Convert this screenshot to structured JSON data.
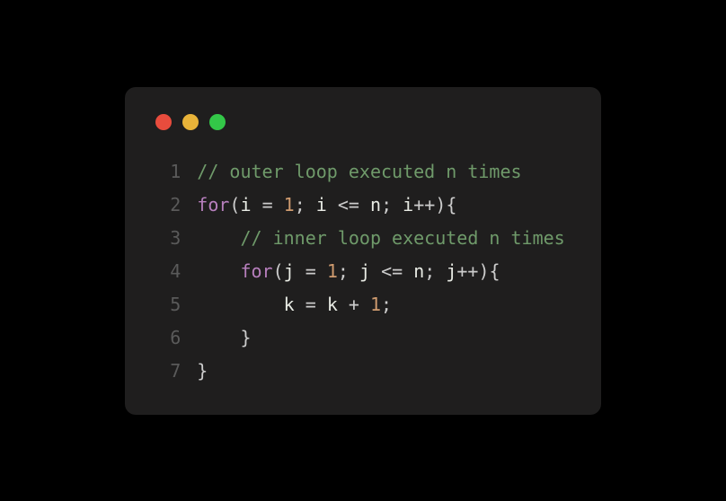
{
  "code": {
    "lines": [
      {
        "num": "1",
        "indent": "",
        "tokens": [
          {
            "cls": "comment",
            "t": "// outer loop executed n times"
          }
        ]
      },
      {
        "num": "2",
        "indent": "",
        "tokens": [
          {
            "cls": "keyword",
            "t": "for"
          },
          {
            "cls": "paren",
            "t": "("
          },
          {
            "cls": "var",
            "t": "i"
          },
          {
            "cls": "plain",
            "t": " "
          },
          {
            "cls": "op",
            "t": "="
          },
          {
            "cls": "plain",
            "t": " "
          },
          {
            "cls": "num",
            "t": "1"
          },
          {
            "cls": "semi",
            "t": ";"
          },
          {
            "cls": "plain",
            "t": " "
          },
          {
            "cls": "var",
            "t": "i"
          },
          {
            "cls": "plain",
            "t": " "
          },
          {
            "cls": "op",
            "t": "<="
          },
          {
            "cls": "plain",
            "t": " "
          },
          {
            "cls": "var",
            "t": "n"
          },
          {
            "cls": "semi",
            "t": ";"
          },
          {
            "cls": "plain",
            "t": " "
          },
          {
            "cls": "var",
            "t": "i"
          },
          {
            "cls": "op",
            "t": "++"
          },
          {
            "cls": "paren",
            "t": ")"
          },
          {
            "cls": "brace",
            "t": "{"
          }
        ]
      },
      {
        "num": "3",
        "indent": "    ",
        "tokens": [
          {
            "cls": "comment",
            "t": "// inner loop executed n times"
          }
        ]
      },
      {
        "num": "4",
        "indent": "    ",
        "tokens": [
          {
            "cls": "keyword",
            "t": "for"
          },
          {
            "cls": "paren",
            "t": "("
          },
          {
            "cls": "var",
            "t": "j"
          },
          {
            "cls": "plain",
            "t": " "
          },
          {
            "cls": "op",
            "t": "="
          },
          {
            "cls": "plain",
            "t": " "
          },
          {
            "cls": "num",
            "t": "1"
          },
          {
            "cls": "semi",
            "t": ";"
          },
          {
            "cls": "plain",
            "t": " "
          },
          {
            "cls": "var",
            "t": "j"
          },
          {
            "cls": "plain",
            "t": " "
          },
          {
            "cls": "op",
            "t": "<="
          },
          {
            "cls": "plain",
            "t": " "
          },
          {
            "cls": "var",
            "t": "n"
          },
          {
            "cls": "semi",
            "t": ";"
          },
          {
            "cls": "plain",
            "t": " "
          },
          {
            "cls": "var",
            "t": "j"
          },
          {
            "cls": "op",
            "t": "++"
          },
          {
            "cls": "paren",
            "t": ")"
          },
          {
            "cls": "brace",
            "t": "{"
          }
        ]
      },
      {
        "num": "5",
        "indent": "        ",
        "tokens": [
          {
            "cls": "var",
            "t": "k"
          },
          {
            "cls": "plain",
            "t": " "
          },
          {
            "cls": "op",
            "t": "="
          },
          {
            "cls": "plain",
            "t": " "
          },
          {
            "cls": "var",
            "t": "k"
          },
          {
            "cls": "plain",
            "t": " "
          },
          {
            "cls": "op",
            "t": "+"
          },
          {
            "cls": "plain",
            "t": " "
          },
          {
            "cls": "num",
            "t": "1"
          },
          {
            "cls": "semi",
            "t": ";"
          }
        ]
      },
      {
        "num": "6",
        "indent": "    ",
        "tokens": [
          {
            "cls": "brace",
            "t": "}"
          }
        ]
      },
      {
        "num": "7",
        "indent": "",
        "tokens": [
          {
            "cls": "brace",
            "t": "}"
          }
        ]
      }
    ]
  }
}
